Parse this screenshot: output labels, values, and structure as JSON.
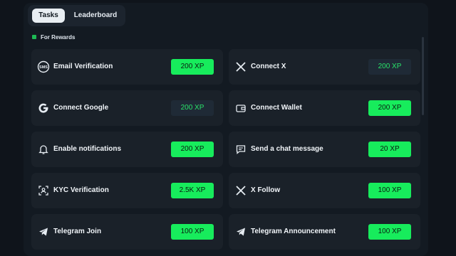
{
  "tabs": [
    {
      "label": "Tasks",
      "active": true
    },
    {
      "label": "Leaderboard",
      "active": false
    }
  ],
  "section_title": "For Rewards",
  "accent": "#17ec5c",
  "tasks": [
    {
      "label": "Email Verification",
      "reward": "200 XP",
      "icon": "email-icon",
      "dim": false
    },
    {
      "label": "Connect X",
      "reward": "200 XP",
      "icon": "x-logo-icon",
      "dim": true
    },
    {
      "label": "Connect Google",
      "reward": "200 XP",
      "icon": "google-icon",
      "dim": true
    },
    {
      "label": "Connect Wallet",
      "reward": "200 XP",
      "icon": "wallet-icon",
      "dim": false
    },
    {
      "label": "Enable notifications",
      "reward": "200 XP",
      "icon": "bell-icon",
      "dim": false
    },
    {
      "label": "Send a chat message",
      "reward": "20 XP",
      "icon": "chat-icon",
      "dim": false
    },
    {
      "label": "KYC Verification",
      "reward": "2.5K XP",
      "icon": "id-card-icon",
      "dim": false
    },
    {
      "label": "X Follow",
      "reward": "100 XP",
      "icon": "x-logo-icon",
      "dim": false
    },
    {
      "label": "Telegram Join",
      "reward": "100 XP",
      "icon": "telegram-icon",
      "dim": false
    },
    {
      "label": "Telegram Announcement",
      "reward": "100 XP",
      "icon": "telegram-icon",
      "dim": false
    }
  ]
}
